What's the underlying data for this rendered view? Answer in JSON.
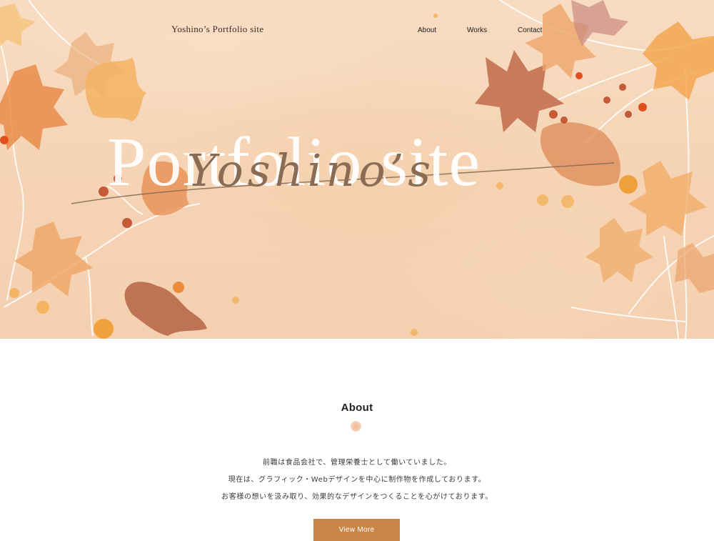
{
  "header": {
    "site_title": "Yoshino’s Portfolio site",
    "nav": [
      {
        "label": "About"
      },
      {
        "label": "Works"
      },
      {
        "label": "Contact"
      }
    ]
  },
  "hero": {
    "background_text": "Portfolio site",
    "script_text": "Yoshino’s"
  },
  "about": {
    "heading": "About",
    "paragraphs": [
      "前職は食品会社で、管理栄養士として働いていました。",
      "現在は、グラフィック・Webデザインを中心に制作物を作成しております。",
      "お客様の想いを汲み取り、効果的なデザインをつくることを心がけております。"
    ],
    "button_label": "View More"
  },
  "colors": {
    "hero_background": "#f5d3b4",
    "accent": "#c98546",
    "leaf_orange": "#f0a85a",
    "leaf_brown": "#b8684a"
  }
}
